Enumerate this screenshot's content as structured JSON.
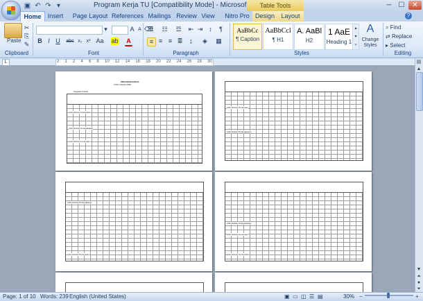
{
  "window": {
    "title": "Program Kerja TU [Compatibility Mode] - Microsoft Word",
    "context_tab_group": "Table Tools",
    "controls": {
      "minimize": "─",
      "maximize": "☐",
      "close": "✕"
    }
  },
  "quick_access": [
    "save-icon",
    "undo-icon",
    "redo-icon",
    "customize-icon"
  ],
  "tabs": [
    "Home",
    "Insert",
    "Page Layout",
    "References",
    "Mailings",
    "Review",
    "View",
    "Nitro Pro",
    "Design",
    "Layout"
  ],
  "active_tab": "Home",
  "ribbon": {
    "clipboard": {
      "label": "Clipboard",
      "paste": "Paste"
    },
    "font": {
      "label": "Font",
      "font_name": "",
      "font_size": "",
      "bold": "B",
      "italic": "I",
      "underline": "U",
      "strike": "abc",
      "subscript": "x₂",
      "superscript": "x²",
      "change_case": "Aa",
      "grow": "A",
      "shrink": "A"
    },
    "paragraph": {
      "label": "Paragraph"
    },
    "styles": {
      "label": "Styles",
      "items": [
        {
          "sample": "AaBbCc",
          "name": "¶ Caption"
        },
        {
          "sample": "AaBbCcl",
          "name": "¶ H1"
        },
        {
          "sample": "A. AaBl",
          "name": "H2"
        },
        {
          "sample": "1 AaE",
          "name": "Heading 1"
        }
      ],
      "change_styles": "Change Styles"
    },
    "editing": {
      "label": "Editing",
      "find": "Find",
      "replace": "Replace",
      "select": "Select"
    }
  },
  "ruler": {
    "numbers": [
      "2",
      "1",
      "2",
      "4",
      "6",
      "8",
      "10",
      "12",
      "14",
      "16",
      "18",
      "20",
      "22",
      "24",
      "26",
      "28",
      "30"
    ]
  },
  "status": {
    "page": "Page: 1 of 10",
    "words": "Words: 239",
    "language": "English (United States)",
    "zoom": "30%"
  },
  "document": {
    "page1_title": "PROGRAM KERJA",
    "page1_subtitle": "TATA USAHA SMP",
    "section_labels": [
      "Kegiatan Pokok",
      "Administrasi Kesiswaan",
      "Administrasi Kepegawaian",
      "Administrasi Keuangan",
      "Administrasi Perlengkapan",
      "Administrasi Persuratan"
    ]
  }
}
